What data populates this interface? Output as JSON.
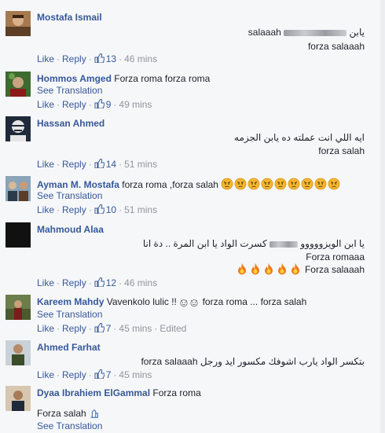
{
  "comments": [
    {
      "author": "Mostafa Ismail",
      "lines": [
        "يابن",
        "salaaah",
        "forza salaaah"
      ],
      "like": "Like",
      "reply": "Reply",
      "likes": "13",
      "time": "46 mins"
    },
    {
      "author": "Hommos Amged",
      "inline": "Forza roma forza roma",
      "translation": "See Translation",
      "like": "Like",
      "reply": "Reply",
      "likes": "9",
      "time": "49 mins"
    },
    {
      "author": "Hassan Ahmed",
      "lines": [
        "ايه اللي انت عملته ده يابن الجزمه",
        "forza salah"
      ],
      "like": "Like",
      "reply": "Reply",
      "likes": "14",
      "time": "51 mins"
    },
    {
      "author": "Ayman M. Mostafa",
      "inline": "forza roma ,forza salah",
      "emoji": "angry-face-icon",
      "emoji_count": 9,
      "translation": "See Translation",
      "like": "Like",
      "reply": "Reply",
      "likes": "10",
      "time": "51 mins"
    },
    {
      "author": "Mahmoud Alaa",
      "lines": [
        "كسرت الواد يا ابن المرة .. دة انا",
        "يا ابن الويزووووو",
        "Forza romaaa",
        "Forza salaaah"
      ],
      "emoji": "fire-icon",
      "emoji_count": 5,
      "like": "Like",
      "reply": "Reply",
      "likes": "12",
      "time": "46 mins"
    },
    {
      "author": "Kareem Mahdy",
      "inline_pre": "Vavenkolo lulic !!",
      "inline_post": "forza roma ... forza salah",
      "emoji": "devil-face-icon",
      "translation": "See Translation",
      "like": "Like",
      "reply": "Reply",
      "likes": "7",
      "time": "45 mins",
      "edited": "Edited"
    },
    {
      "author": "Ahmed Farhat",
      "lines": [
        "بتكسر الواد يارب اشوفك مكسور ايد ورجل",
        "forza salaaah"
      ],
      "like": "Like",
      "reply": "Reply",
      "likes": "7",
      "time": "45 mins"
    },
    {
      "author": "Dyaa Ibrahiem ElGammal",
      "inline": "Forza roma",
      "second": "Forza salah",
      "translation": "See Translation"
    }
  ],
  "colors": {
    "link": "#365899",
    "meta": "#90949c",
    "background": "#f6f7f9"
  }
}
